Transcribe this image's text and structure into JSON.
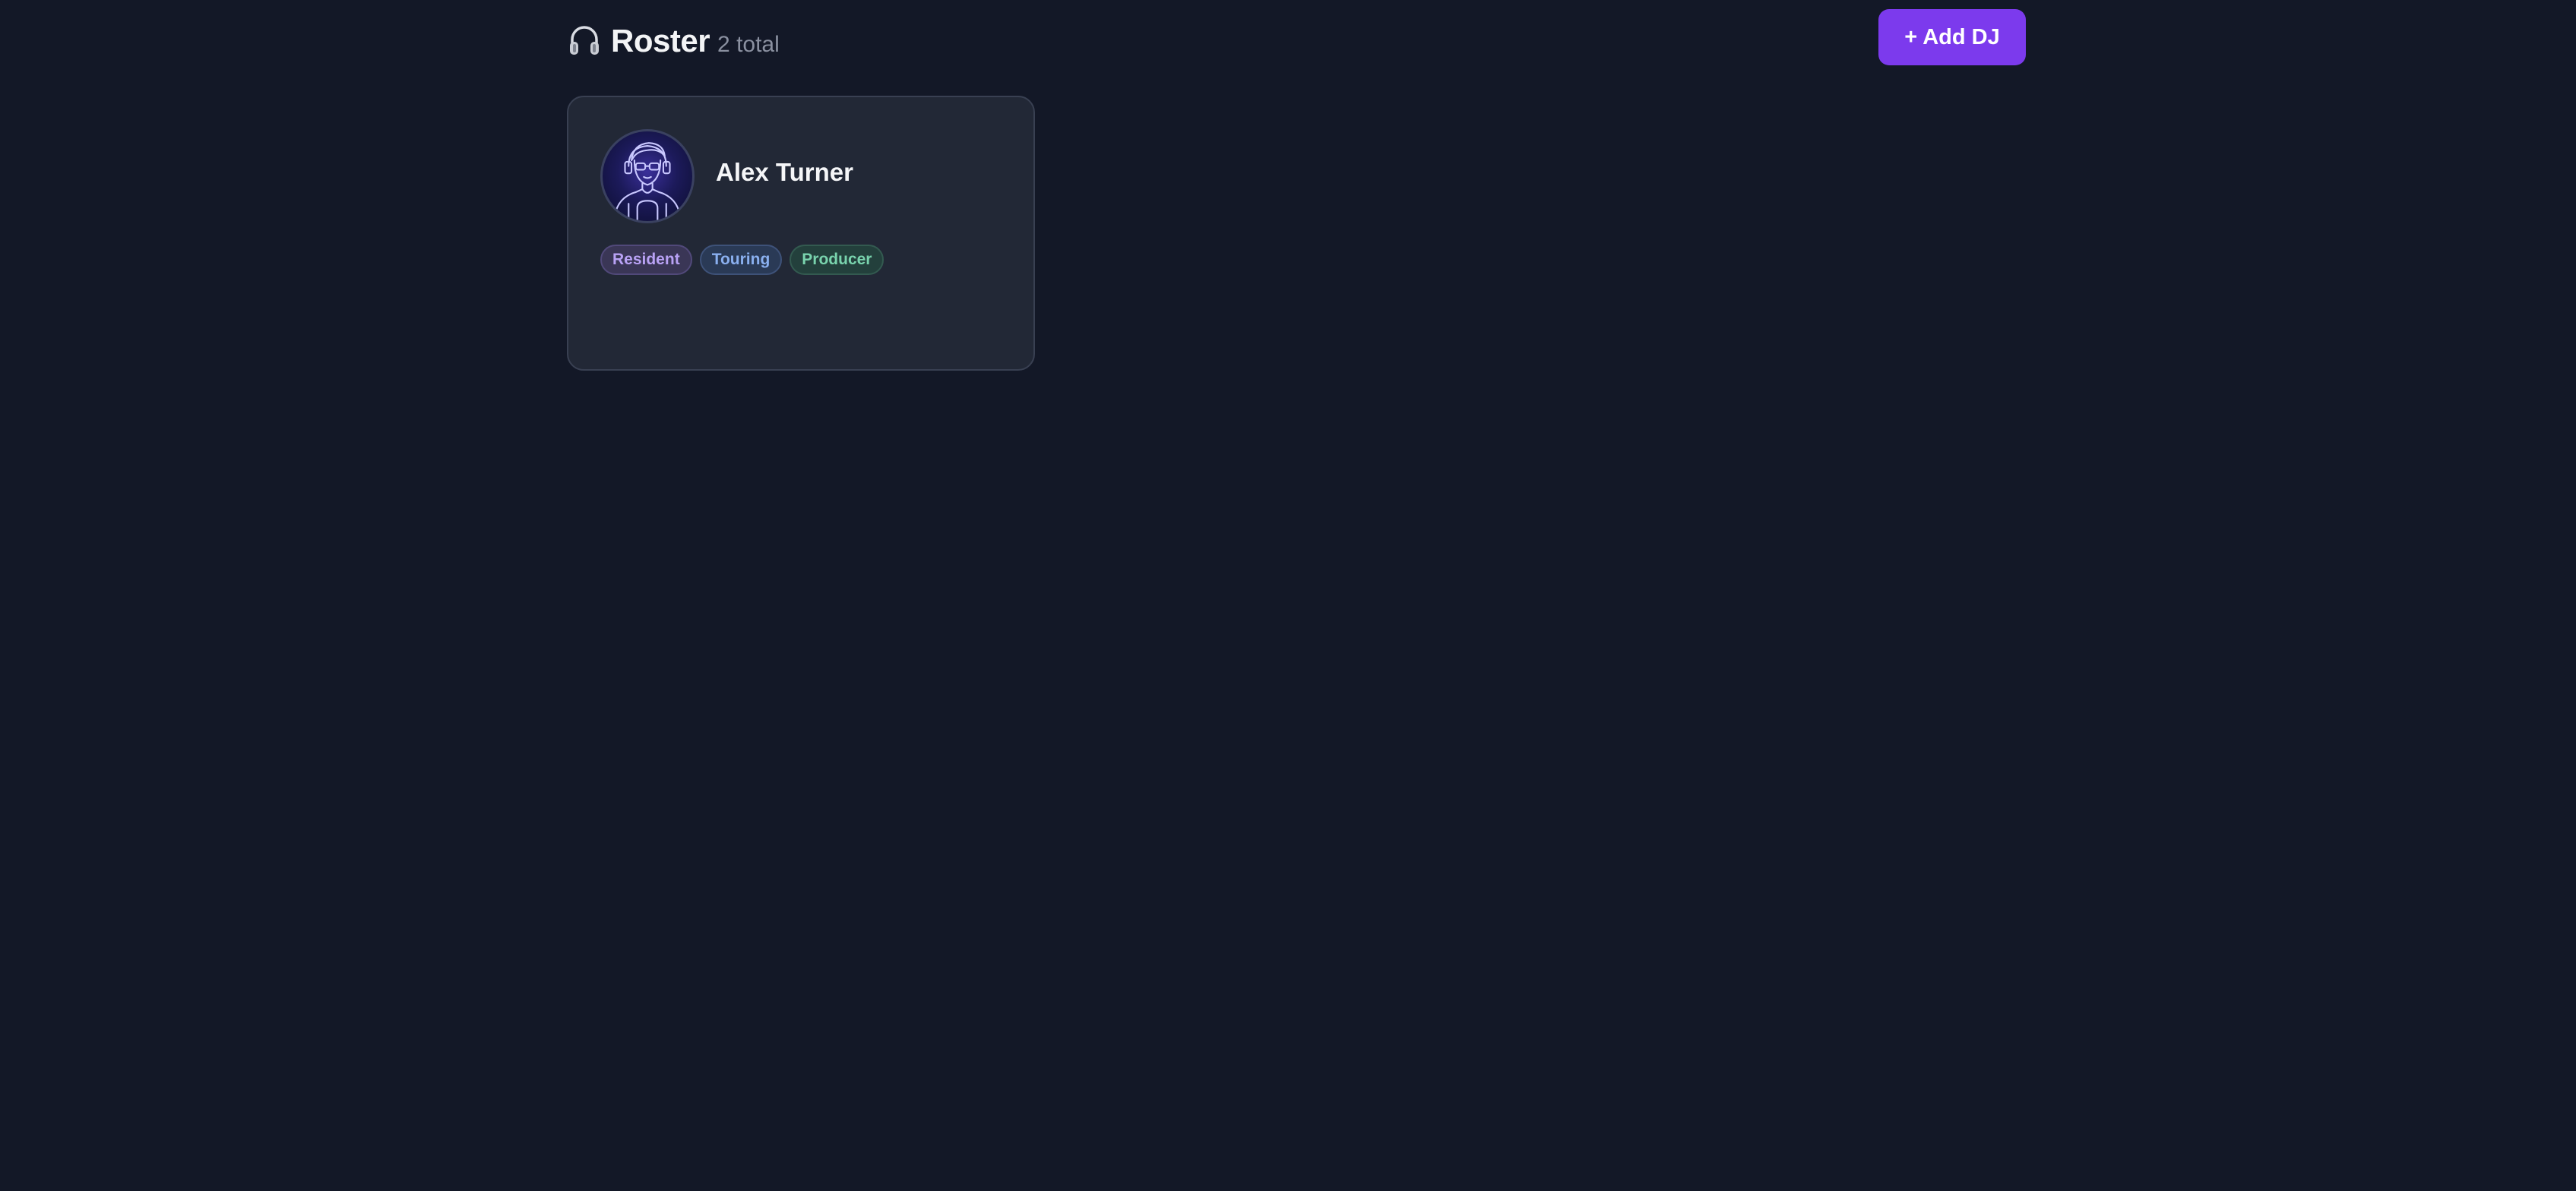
{
  "header": {
    "title": "Roster",
    "count": "2 total",
    "add_button_label": "+ Add DJ"
  },
  "icons": {
    "title_icon": "headphones-icon",
    "avatar": "dj-avatar-illustration"
  },
  "colors": {
    "background": "#131827",
    "card": "#222836",
    "accent": "#7c3aed"
  },
  "roster": [
    {
      "name": "Alex Turner",
      "tags": [
        "Resident",
        "Touring",
        "Producer"
      ]
    }
  ]
}
